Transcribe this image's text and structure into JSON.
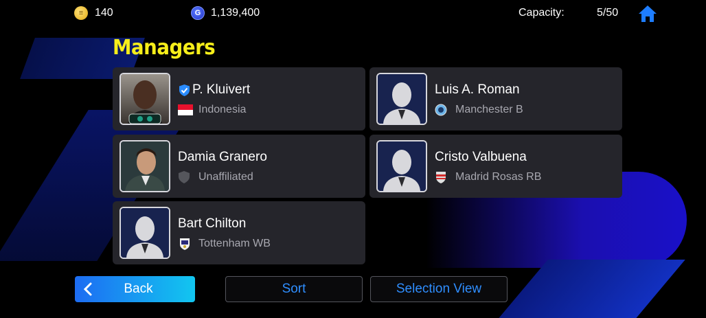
{
  "topbar": {
    "ecoins": "140",
    "gp": "1,139,400",
    "capacity_label": "Capacity:",
    "capacity_value": "5/50",
    "home_icon": "home-icon"
  },
  "title": "Managers",
  "managers": [
    {
      "name": "P. Kluivert",
      "club": "Indonesia",
      "club_icon": "indonesia-flag-icon",
      "verified": true,
      "portrait": "photo"
    },
    {
      "name": "Luis A. Roman",
      "club": "Manchester B",
      "club_icon": "manchester-b-crest-icon",
      "verified": false,
      "portrait": "silhouette"
    },
    {
      "name": "Damia Granero",
      "club": "Unaffiliated",
      "club_icon": "unaffiliated-shield-icon",
      "verified": false,
      "portrait": "photo"
    },
    {
      "name": "Cristo Valbuena",
      "club": "Madrid Rosas RB",
      "club_icon": "madrid-rosas-crest-icon",
      "verified": false,
      "portrait": "silhouette"
    },
    {
      "name": "Bart Chilton",
      "club": "Tottenham WB",
      "club_icon": "tottenham-wb-crest-icon",
      "verified": false,
      "portrait": "silhouette"
    }
  ],
  "buttons": {
    "back": "Back",
    "sort": "Sort",
    "selection_view": "Selection View"
  },
  "colors": {
    "title": "#f6ee1a",
    "accent_blue": "#2f8eff",
    "card_bg": "#25252b"
  }
}
